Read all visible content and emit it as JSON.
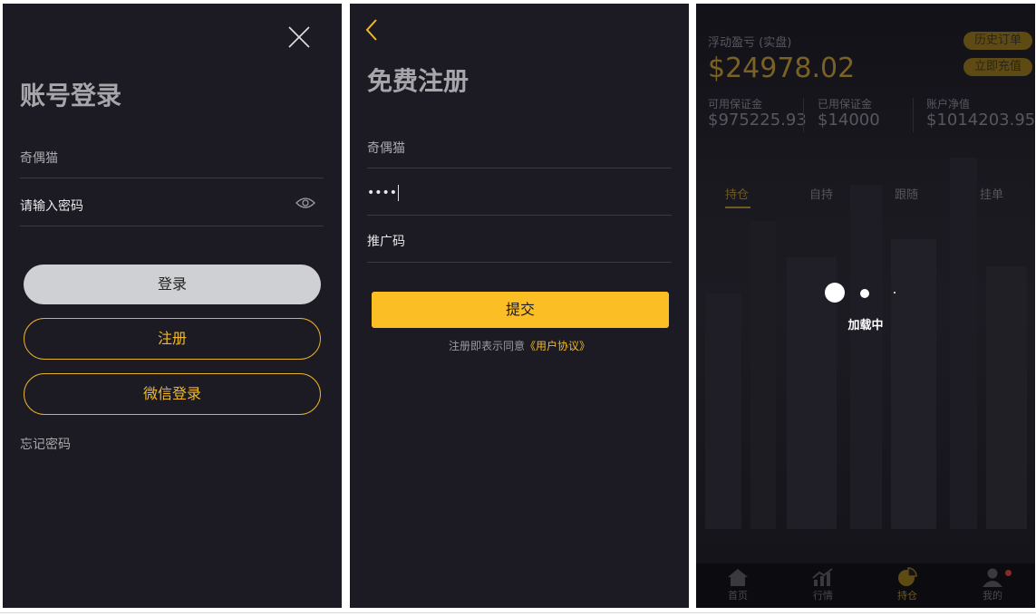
{
  "login": {
    "title": "账号登录",
    "username_value": "奇偶猫",
    "password_placeholder": "请输入密码",
    "login_button": "登录",
    "register_button": "注册",
    "wechat_button": "微信登录",
    "forgot_link": "忘记密码",
    "icons": [
      "close-icon",
      "eye-icon"
    ]
  },
  "register": {
    "title": "免费注册",
    "username_value": "奇偶猫",
    "password_value": "••••",
    "promo_placeholder": "推广码",
    "submit_button": "提交",
    "agree_text": "注册即表示同意",
    "agree_link": "《用户协议》",
    "icons": [
      "back-icon"
    ]
  },
  "positions": {
    "pnl_label": "浮动盈亏 (实盘)",
    "pnl_value": "$24978.02",
    "history_button": "历史订单",
    "recharge_button": "立即充值",
    "stats": [
      {
        "label": "可用保证金",
        "value": "$975225.93"
      },
      {
        "label": "已用保证金",
        "value": "$14000"
      },
      {
        "label": "账户净值",
        "value": "$1014203.95"
      }
    ],
    "tabs": [
      "持仓",
      "自持",
      "跟随",
      "挂单"
    ],
    "active_tab": "持仓",
    "loading_text": "加载中",
    "bottom_nav": [
      {
        "label": "首页",
        "icon": "home-icon"
      },
      {
        "label": "行情",
        "icon": "chart-icon"
      },
      {
        "label": "持仓",
        "icon": "pie-icon"
      },
      {
        "label": "我的",
        "icon": "user-icon"
      }
    ],
    "active_nav": "持仓"
  },
  "colors": {
    "panel_bg": "#1c1b24",
    "accent": "#fbbe24",
    "button_gray": "#cfd0d3"
  }
}
